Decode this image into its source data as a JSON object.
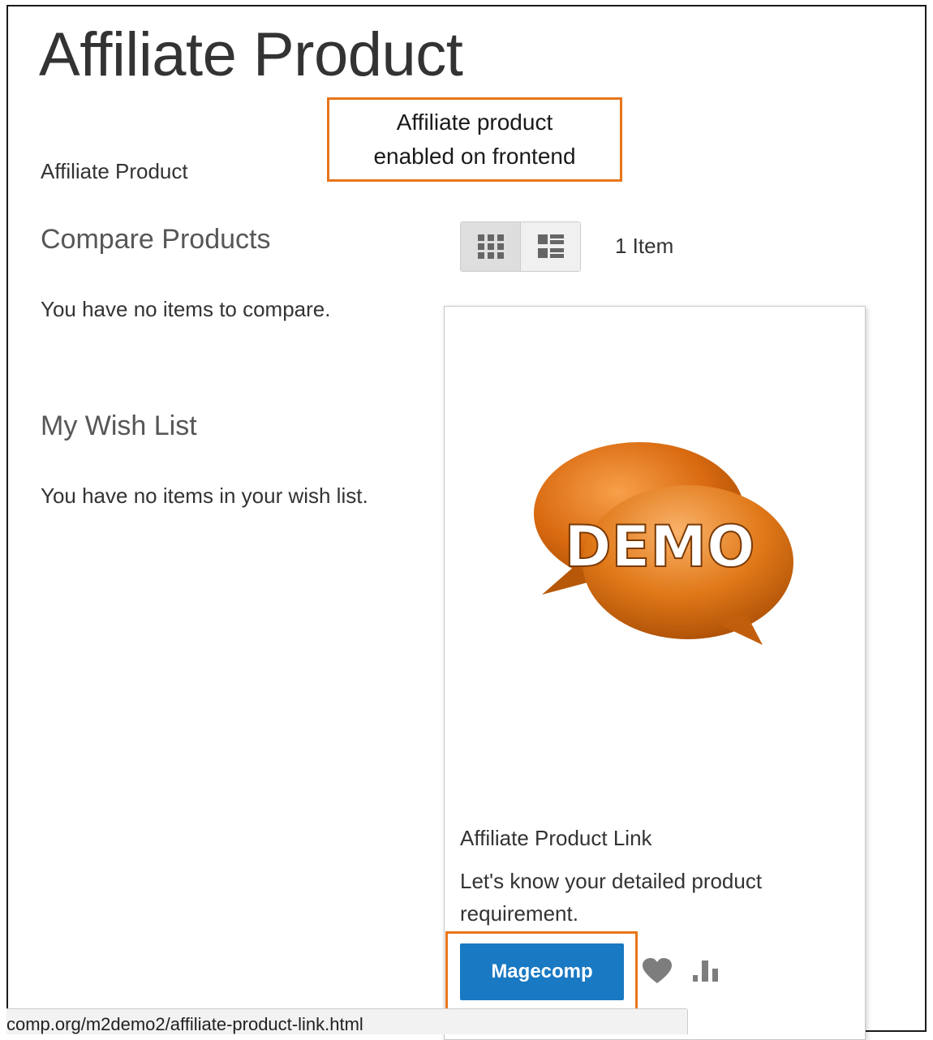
{
  "page": {
    "title": "Affiliate Product"
  },
  "callout": {
    "text": "Affiliate product\nenabled on frontend"
  },
  "breadcrumb": {
    "current": "Affiliate Product"
  },
  "sidebar": {
    "compare": {
      "title": "Compare Products",
      "empty": "You have no items to compare."
    },
    "wishlist": {
      "title": "My Wish List",
      "empty": "You have no items in your wish list."
    }
  },
  "toolbar": {
    "modes": [
      {
        "name": "grid",
        "icon": "grid-icon",
        "active": true
      },
      {
        "name": "list",
        "icon": "list-icon",
        "active": false
      }
    ],
    "amount": "1 Item"
  },
  "product": {
    "image_text": "DEMO",
    "name": "Affiliate Product Link",
    "description": "Let's know your detailed product requirement.",
    "button_label": "Magecomp",
    "actions": [
      {
        "icon": "heart-icon"
      },
      {
        "icon": "compare-icon"
      }
    ]
  },
  "status_bar": {
    "url": "comp.org/m2demo2/affiliate-product-link.html"
  },
  "colors": {
    "accent_orange": "#e8751a",
    "button_blue": "#1979c3",
    "demo_orange": "#d96a10",
    "icon_gray": "#7d7d7d"
  }
}
